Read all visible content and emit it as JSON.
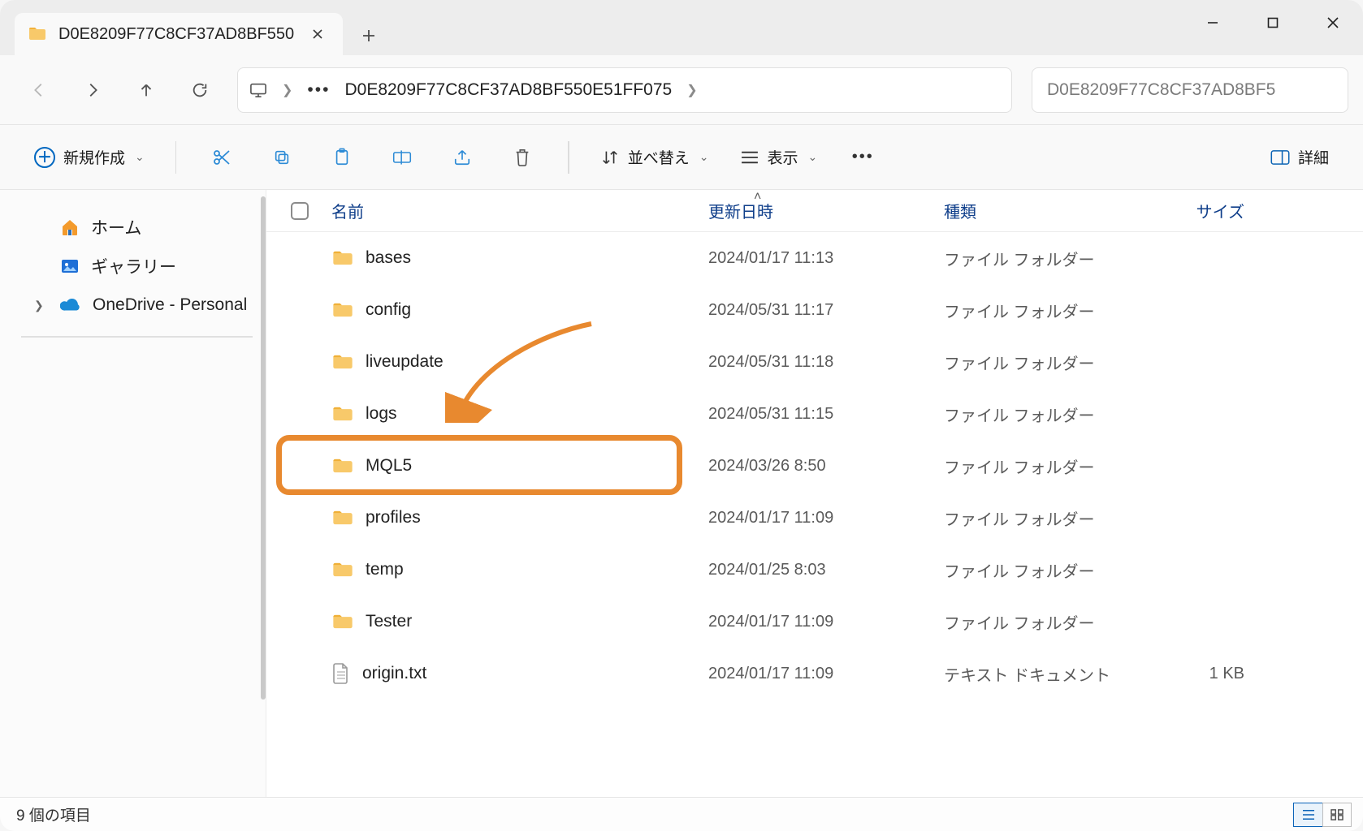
{
  "tab": {
    "title": "D0E8209F77C8CF37AD8BF550"
  },
  "address": {
    "crumb": "D0E8209F77C8CF37AD8BF550E51FF075"
  },
  "search": {
    "placeholder": "D0E8209F77C8CF37AD8BF5"
  },
  "toolbar": {
    "new_label": "新規作成",
    "sort_label": "並べ替え",
    "view_label": "表示",
    "details_label": "詳細"
  },
  "navpane": {
    "home": "ホーム",
    "gallery": "ギャラリー",
    "onedrive": "OneDrive - Personal"
  },
  "columns": {
    "name": "名前",
    "date": "更新日時",
    "type": "種類",
    "size": "サイズ"
  },
  "rows": [
    {
      "icon": "folder",
      "name": "bases",
      "date": "2024/01/17 11:13",
      "type": "ファイル フォルダー",
      "size": ""
    },
    {
      "icon": "folder",
      "name": "config",
      "date": "2024/05/31 11:17",
      "type": "ファイル フォルダー",
      "size": ""
    },
    {
      "icon": "folder",
      "name": "liveupdate",
      "date": "2024/05/31 11:18",
      "type": "ファイル フォルダー",
      "size": ""
    },
    {
      "icon": "folder",
      "name": "logs",
      "date": "2024/05/31 11:15",
      "type": "ファイル フォルダー",
      "size": ""
    },
    {
      "icon": "folder",
      "name": "MQL5",
      "date": "2024/03/26 8:50",
      "type": "ファイル フォルダー",
      "size": "",
      "highlight": true
    },
    {
      "icon": "folder",
      "name": "profiles",
      "date": "2024/01/17 11:09",
      "type": "ファイル フォルダー",
      "size": ""
    },
    {
      "icon": "folder",
      "name": "temp",
      "date": "2024/01/25 8:03",
      "type": "ファイル フォルダー",
      "size": ""
    },
    {
      "icon": "folder",
      "name": "Tester",
      "date": "2024/01/17 11:09",
      "type": "ファイル フォルダー",
      "size": ""
    },
    {
      "icon": "file",
      "name": "origin.txt",
      "date": "2024/01/17 11:09",
      "type": "テキスト ドキュメント",
      "size": "1 KB"
    }
  ],
  "status": {
    "count_text": "9 個の項目"
  }
}
